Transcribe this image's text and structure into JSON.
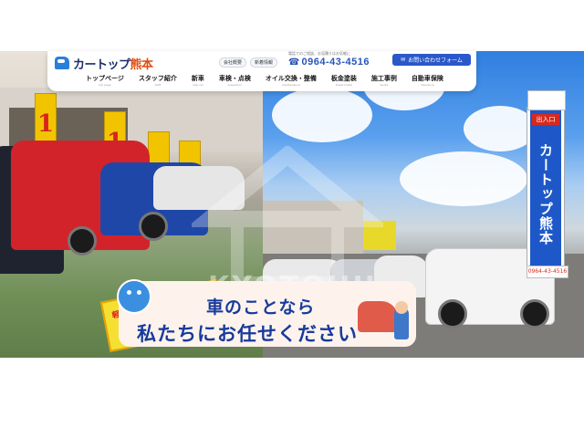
{
  "header": {
    "logo_text_main": "カートップ",
    "logo_text_accent": "熊本",
    "links": [
      "会社概要",
      "新着情報"
    ],
    "tel_note": "電話でのご相談、お見積りはお気軽に",
    "tel_number": "0964-43-4516",
    "contact_label": "お問い合わせフォーム"
  },
  "nav": [
    {
      "label": "トップページ",
      "sub": "top page"
    },
    {
      "label": "スタッフ紹介",
      "sub": "staff"
    },
    {
      "label": "新車",
      "sub": "new car"
    },
    {
      "label": "車検・点検",
      "sub": "inspection"
    },
    {
      "label": "オイル交換・整備",
      "sub": "maintenance"
    },
    {
      "label": "板金塗装",
      "sub": "sheet metal"
    },
    {
      "label": "施工事例",
      "sub": "works"
    },
    {
      "label": "自動車保険",
      "sub": "insurance"
    }
  ],
  "hero": {
    "banner_line1": "車のことなら",
    "banner_line2": "私たちにお任せください",
    "store_sign_entry": "出入口",
    "store_sign_name": "カートップ熊本",
    "store_sign_tel": "0964-43-4516",
    "lot_sign_text": "軽自動車",
    "flag_text": "1",
    "watermark": "KYOTOHU"
  },
  "colors": {
    "brand_blue": "#1e58c8",
    "brand_navy": "#1c2c6e",
    "accent_orange": "#e04c12",
    "banner_text": "#183a9c"
  }
}
